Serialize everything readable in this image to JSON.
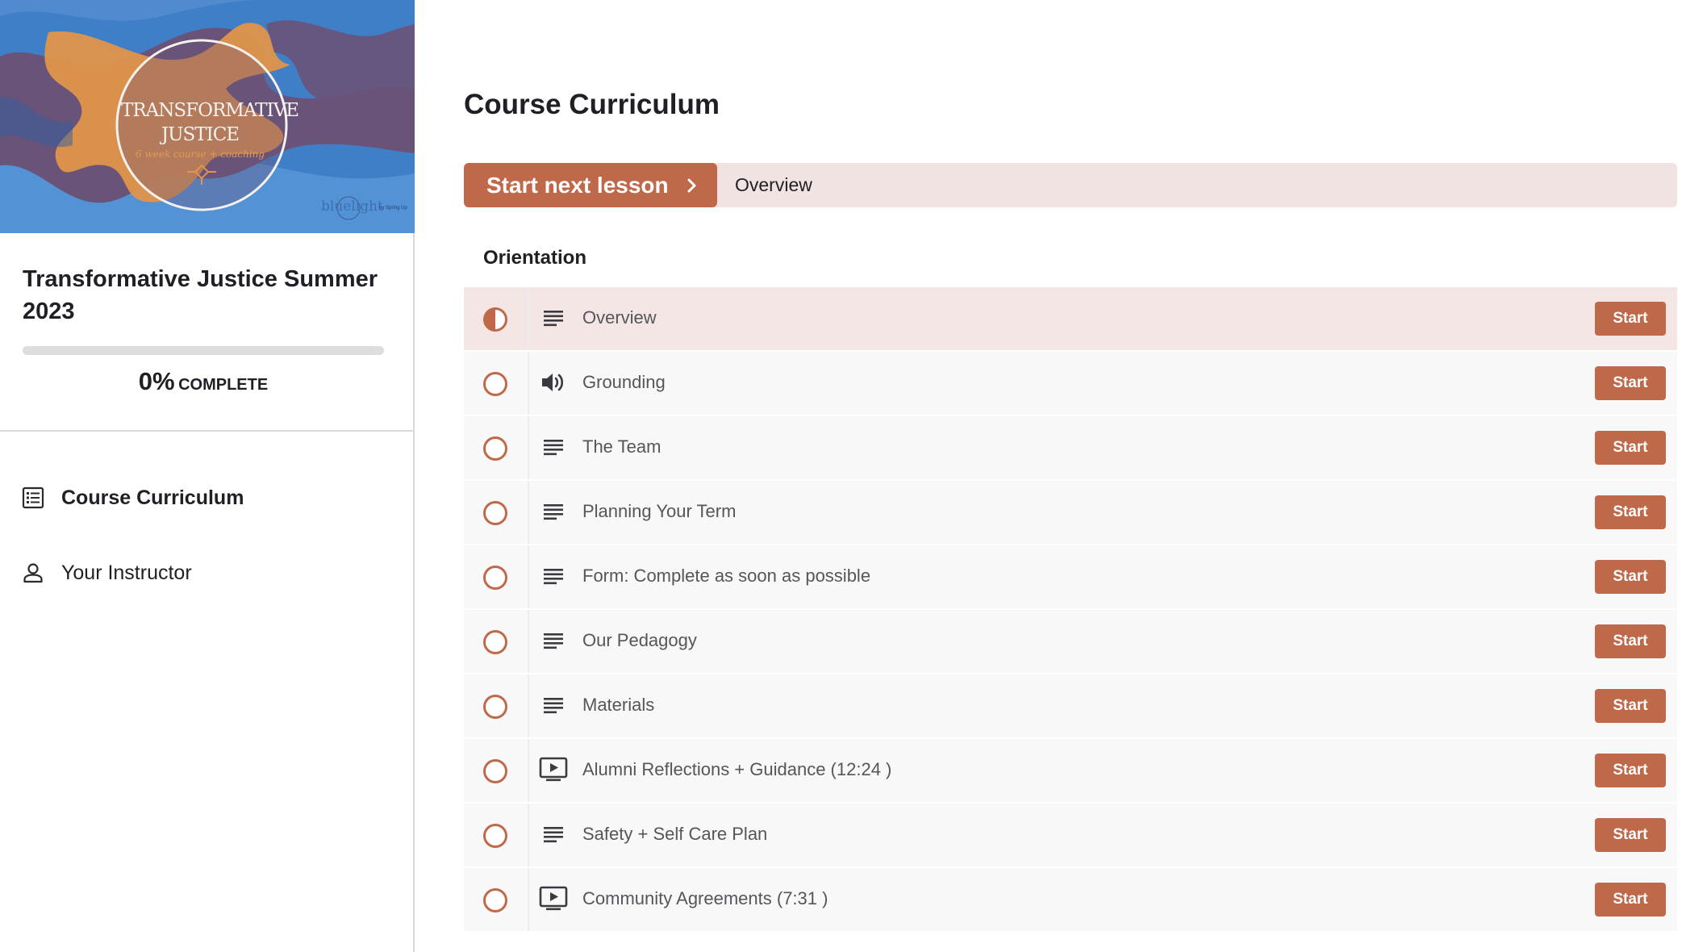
{
  "colors": {
    "accent": "#c0694a",
    "accent_light": "#f1e3e1",
    "current_row": "#f4e6e4",
    "row_bg": "#f8f8f8",
    "text_dark": "#1f1f26",
    "text_muted": "#55555c"
  },
  "sidebar": {
    "hero": {
      "title_line1": "TRANSFORMATIVE",
      "title_line2": "JUSTICE",
      "subtitle": "6 week course + coaching",
      "brand": "bluelight",
      "brand_sub": "by Spring Up"
    },
    "course_title": "Transformative Justice Summer 2023",
    "progress": {
      "percent": 0,
      "percent_label": "0%",
      "complete_label": "COMPLETE"
    },
    "nav": [
      {
        "label": "Course Curriculum",
        "icon": "curriculum-list-icon",
        "active": true
      },
      {
        "label": "Your Instructor",
        "icon": "person-icon",
        "active": false
      }
    ]
  },
  "main": {
    "page_title": "Course Curriculum",
    "next_lesson": {
      "button_label": "Start next lesson",
      "lesson_name": "Overview"
    },
    "section": {
      "title": "Orientation",
      "lessons": [
        {
          "title": "Overview",
          "type": "text-lines-icon",
          "status": "in-progress",
          "button": "Start"
        },
        {
          "title": "Grounding",
          "type": "speaker-icon",
          "status": "not-started",
          "button": "Start"
        },
        {
          "title": "The Team",
          "type": "text-lines-icon",
          "status": "not-started",
          "button": "Start"
        },
        {
          "title": "Planning Your Term",
          "type": "text-lines-icon",
          "status": "not-started",
          "button": "Start"
        },
        {
          "title": "Form: Complete as soon as possible",
          "type": "text-lines-icon",
          "status": "not-started",
          "button": "Start"
        },
        {
          "title": "Our Pedagogy",
          "type": "text-lines-icon",
          "status": "not-started",
          "button": "Start"
        },
        {
          "title": "Materials",
          "type": "text-lines-icon",
          "status": "not-started",
          "button": "Start"
        },
        {
          "title": "Alumni Reflections + Guidance (12:24 )",
          "type": "video-icon",
          "status": "not-started",
          "button": "Start"
        },
        {
          "title": "Safety + Self Care Plan",
          "type": "text-lines-icon",
          "status": "not-started",
          "button": "Start"
        },
        {
          "title": "Community Agreements (7:31 )",
          "type": "video-icon",
          "status": "not-started",
          "button": "Start"
        }
      ]
    }
  }
}
